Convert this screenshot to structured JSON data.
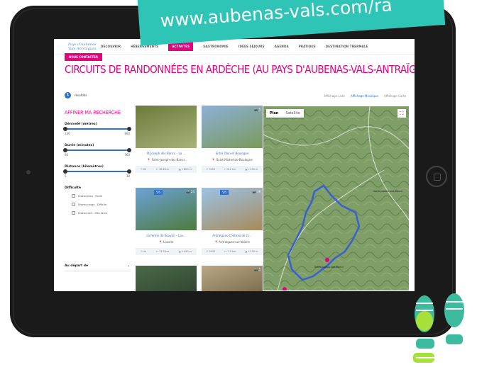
{
  "banner": {
    "url_text": "www.aubenas-vals.com/ra"
  },
  "site": {
    "logo": "Pays d'Aubenas Vals Antraigues",
    "nav": [
      "DÉCOUVRIR",
      "HÉBERGEMENTS",
      "ACTIVITÉS",
      "GASTRONOMIE",
      "IDÉES SÉJOURS",
      "AGENDA",
      "PRATIQUE",
      "DESTINATION THERMALE"
    ],
    "active_nav": "ACTIVITÉS",
    "contact_button": "NOUS CONTACTER",
    "page_title": "CIRCUITS DE RANDONNÉES EN ARDÈCHE (AU PAYS D'AUBENAS-VALS-ANTRAÏGUES)"
  },
  "results": {
    "count": "1",
    "label": "résultats"
  },
  "views": {
    "list": "Affichage Liste",
    "mosaic": "Affichage Mosaïque",
    "map": "Affichage Carte"
  },
  "filters": {
    "title": "AFFINER MA RECHERCHE",
    "denivele": {
      "label": "Dénivelé (mètres)",
      "min": "130",
      "max": "800"
    },
    "duree": {
      "label": "Durée (minutes)",
      "min": "90",
      "max": "360"
    },
    "distance": {
      "label": "Distance (kilomètres)",
      "min": "5",
      "max": "18"
    },
    "difficulty_title": "Difficulté",
    "difficulty_options": [
      "Niveau bleu - Facile",
      "Niveau rouge - Difficile",
      "Niveau vert - Très facile"
    ],
    "depart_label": "Au départ de"
  },
  "cards": [
    {
      "title": "St Joseph des Bancs – La ...",
      "place": "Saint-Joseph-des-Bancs",
      "time": "6h",
      "distance": "18.8 km",
      "elevation": "+800 m",
      "photos": "",
      "likes": "",
      "colors": [
        "#6b7a3a",
        "#a8b27a"
      ]
    },
    {
      "title": "Entre Olon et Boulogne",
      "place": "Saint-Michel-de-Boulogne",
      "time": "3h55",
      "distance": "8.1 km",
      "elevation": "+250 m",
      "photos": "5",
      "likes": "",
      "colors": [
        "#8cb0d8",
        "#7a9a5a"
      ]
    },
    {
      "title": "La ferme de Rouyon – Lav...",
      "place": "Lavoile",
      "time": "4h",
      "distance": "13.5 km",
      "elevation": "+450 m",
      "photos": "24",
      "likes": "5/5",
      "colors": [
        "#6aa3d9",
        "#4f7a3c"
      ]
    },
    {
      "title": "Antraigues-Château de Cr...",
      "place": "Antraigues-sur-Volane",
      "time": "3h30",
      "distance": "7.5 km",
      "elevation": "+330 m",
      "photos": "19",
      "likes": "5/5",
      "colors": [
        "#9ac3e6",
        "#a88a5a"
      ]
    },
    {
      "title": "",
      "place": "",
      "time": "",
      "distance": "",
      "elevation": "",
      "photos": "",
      "likes": "",
      "colors": [
        "#4a6a4a",
        "#2a3a2a"
      ]
    },
    {
      "title": "",
      "place": "",
      "time": "",
      "distance": "",
      "elevation": "",
      "photos": "5",
      "likes": "",
      "colors": [
        "#b8a888",
        "#6a5a3a"
      ]
    }
  ],
  "map": {
    "tab_plan": "Plan",
    "tab_satellite": "Satellite",
    "town1": "Saint-Joseph-des-Bancs",
    "town2": "Saint-Joseph-des-Bancs"
  }
}
